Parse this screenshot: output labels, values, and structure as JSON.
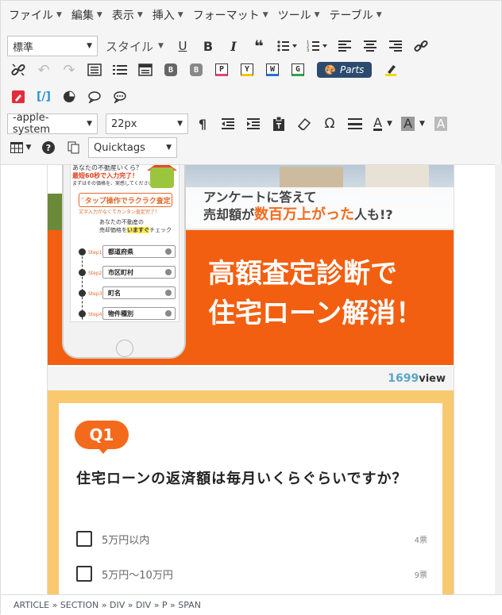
{
  "menubar": [
    {
      "label": "ファイル"
    },
    {
      "label": "編集"
    },
    {
      "label": "表示"
    },
    {
      "label": "挿入"
    },
    {
      "label": "フォーマット"
    },
    {
      "label": "ツール"
    },
    {
      "label": "テーブル"
    }
  ],
  "toolbar": {
    "block_format": "標準",
    "style_label": "スタイル",
    "parts_label": "Parts",
    "shortcode_label": "[/]",
    "font_family": "-apple-system",
    "font_size": "22px",
    "quicktags": "Quicktags",
    "tags": {
      "b1": "B",
      "b2": "B",
      "p": "P",
      "y": "Y",
      "w": "W",
      "g": "G"
    },
    "underline": "U",
    "bold": "B",
    "italic": "I",
    "quote": "❝",
    "omega": "Ω",
    "pilcrow": "¶",
    "text_color": "A",
    "bg_color": "A",
    "highlight": "A",
    "accent": "#2c4a6e"
  },
  "hero": {
    "phone_header": "あなたの不動産いくら？",
    "phone_sub": "最短60秒で入力完了！",
    "phone_sub2": "まずはその価格を、実感してください",
    "phone_tap": "タップ操作でラクラク査定",
    "phone_tap_sub": "文字入力がなくてカンタン査定完了！",
    "phone_q1": "あなたの不動産の",
    "phone_q2_pre": "売却価格を",
    "phone_q2_hl": "いますぐ",
    "phone_q2_post": "チェック",
    "steps": [
      {
        "label": "Step1",
        "field": "都道府県"
      },
      {
        "label": "Step2",
        "field": "市区町村"
      },
      {
        "label": "Step3",
        "field": "町名"
      },
      {
        "label": "Step4",
        "field": "物件種別"
      }
    ],
    "subtitle_pre": "アンケートに答えて",
    "subtitle_line2_pre": "売却額が",
    "subtitle_highlight": "数百万上がった",
    "subtitle_line2_post": "人も!?",
    "title_line1": "高額査定診断で",
    "title_line2": "住宅ローン解消！"
  },
  "views": {
    "count": "1699",
    "label": "view"
  },
  "quiz": {
    "badge": "Q1",
    "question": "住宅ローンの返済額は毎月いくらぐらいですか？",
    "options": [
      {
        "label": "5万円以内",
        "count": "4票"
      },
      {
        "label": "5万円〜10万円",
        "count": "9票"
      }
    ]
  },
  "statusbar": {
    "path": "ARTICLE » SECTION » DIV » DIV » P » SPAN"
  }
}
